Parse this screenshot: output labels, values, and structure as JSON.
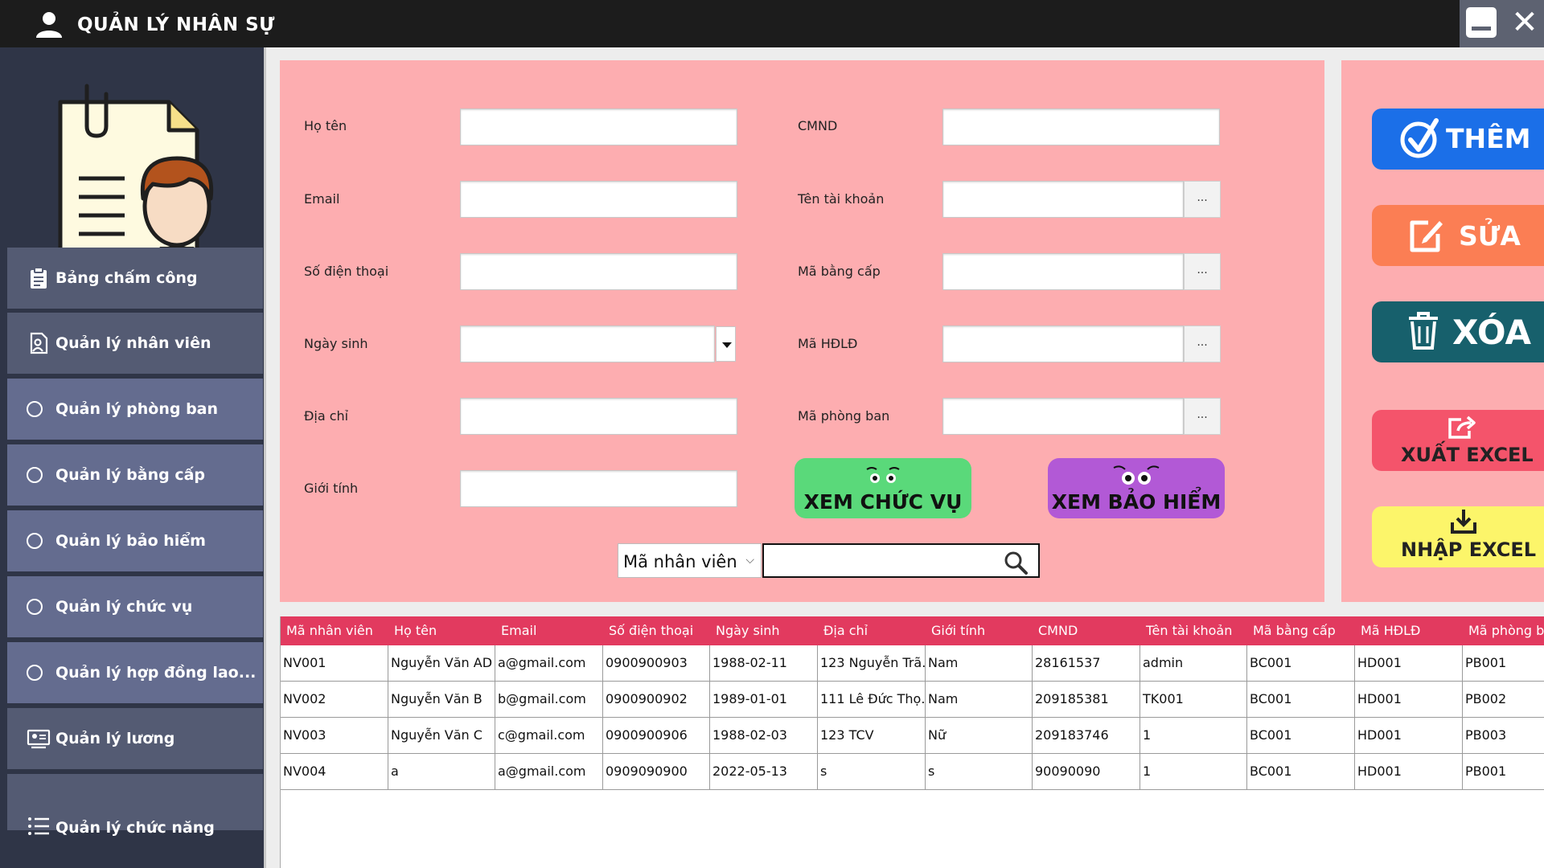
{
  "window": {
    "title": "QUẢN LÝ NHÂN SỰ",
    "close_glyph": "✕"
  },
  "sidebar": {
    "items": [
      {
        "label": "Bảng chấm công",
        "icon": "clipboard-icon"
      },
      {
        "label": "Quản lý nhân viên",
        "icon": "employee-doc-icon"
      },
      {
        "label": "Quản lý phòng ban",
        "icon": "radio"
      },
      {
        "label": "Quản lý bằng cấp",
        "icon": "radio"
      },
      {
        "label": "Quản lý bảo hiểm",
        "icon": "radio"
      },
      {
        "label": "Quản lý chức vụ",
        "icon": "radio"
      },
      {
        "label": "Quản lý hợp đồng lao...",
        "icon": "radio"
      },
      {
        "label": "Quản lý lương",
        "icon": "payroll-icon"
      },
      {
        "label": "Quản lý chức năng",
        "icon": "list-icon"
      }
    ]
  },
  "form": {
    "fields_left": [
      {
        "label": "Họ tên",
        "value": ""
      },
      {
        "label": "Email",
        "value": ""
      },
      {
        "label": "Số điện thoại",
        "value": ""
      },
      {
        "label": "Ngày sinh",
        "value": ""
      },
      {
        "label": "Địa chỉ",
        "value": ""
      },
      {
        "label": "Giới tính",
        "value": ""
      }
    ],
    "fields_right": [
      {
        "label": "CMND",
        "value": ""
      },
      {
        "label": "Tên tài khoản",
        "value": ""
      },
      {
        "label": "Mã bằng cấp",
        "value": ""
      },
      {
        "label": "Mã HĐLĐ",
        "value": ""
      },
      {
        "label": "Mã phòng ban",
        "value": ""
      }
    ],
    "browse_label": "...",
    "view_position_button": "XEM CHỨC VỤ",
    "view_insurance_button": "XEM BẢO HIỂM"
  },
  "search": {
    "selected_field": "Mã nhân viên",
    "query": ""
  },
  "actions": {
    "add": "THÊM",
    "edit": "SỬA",
    "delete": "XÓA",
    "export": "XUẤT EXCEL",
    "import": "NHẬP EXCEL"
  },
  "colors": {
    "title_bar": "#1c1c1c",
    "sidebar": "#2f3547",
    "form_bg": "#fdadb0",
    "table_header": "#e23a5f",
    "add": "#1b6fe8",
    "edit": "#fb7e54",
    "delete": "#17606c",
    "export": "#f4546b",
    "import": "#fcf56a",
    "view_position": "#5ad97a",
    "view_insurance": "#b259d6"
  },
  "table": {
    "columns": [
      "Mã nhân viên",
      "Họ tên",
      "Email",
      "Số điện thoại",
      "Ngày sinh",
      "Địa chỉ",
      "Giới tính",
      "CMND",
      "Tên tài khoản",
      "Mã bằng cấp",
      "Mã HĐLĐ",
      "Mã phòng ba"
    ],
    "rows": [
      [
        "NV001",
        "Nguyễn Văn AD",
        "a@gmail.com",
        "0900900903",
        "1988-02-11",
        "123 Nguyễn Trã...",
        "Nam",
        "28161537",
        "admin",
        "BC001",
        "HD001",
        "PB001"
      ],
      [
        "NV002",
        "Nguyễn Văn B",
        "b@gmail.com",
        "0900900902",
        "1989-01-01",
        "111 Lê Đức Thọ...",
        "Nam",
        "209185381",
        "TK001",
        "BC001",
        "HD001",
        "PB002"
      ],
      [
        "NV003",
        "Nguyễn Văn C",
        "c@gmail.com",
        "0900900906",
        "1988-02-03",
        "123 TCV",
        "Nữ",
        "209183746",
        "1",
        "BC001",
        "HD001",
        "PB003"
      ],
      [
        "NV004",
        "a",
        "a@gmail.com",
        "0909090900",
        "2022-05-13",
        "s",
        "s",
        "90090090",
        "1",
        "BC001",
        "HD001",
        "PB001"
      ]
    ]
  }
}
